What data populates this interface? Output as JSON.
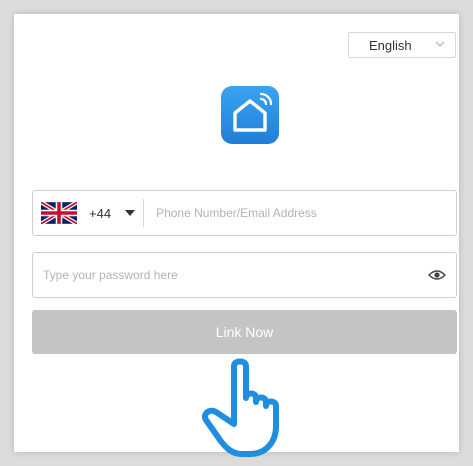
{
  "language_selector": {
    "label": "English",
    "icon": "chevron-down-icon"
  },
  "app_logo": {
    "icon": "smart-home-icon",
    "color": "#2b8ee6"
  },
  "phone": {
    "country_flag": "uk-flag-icon",
    "country_code": "+44",
    "placeholder": "Phone Number/Email Address"
  },
  "password": {
    "placeholder": "Type your password here",
    "icon": "eye-icon"
  },
  "link_button": {
    "label": "Link Now",
    "color": "#c4c4c4"
  },
  "pointer": {
    "icon": "hand-pointer-icon",
    "color": "#1f8de0"
  }
}
